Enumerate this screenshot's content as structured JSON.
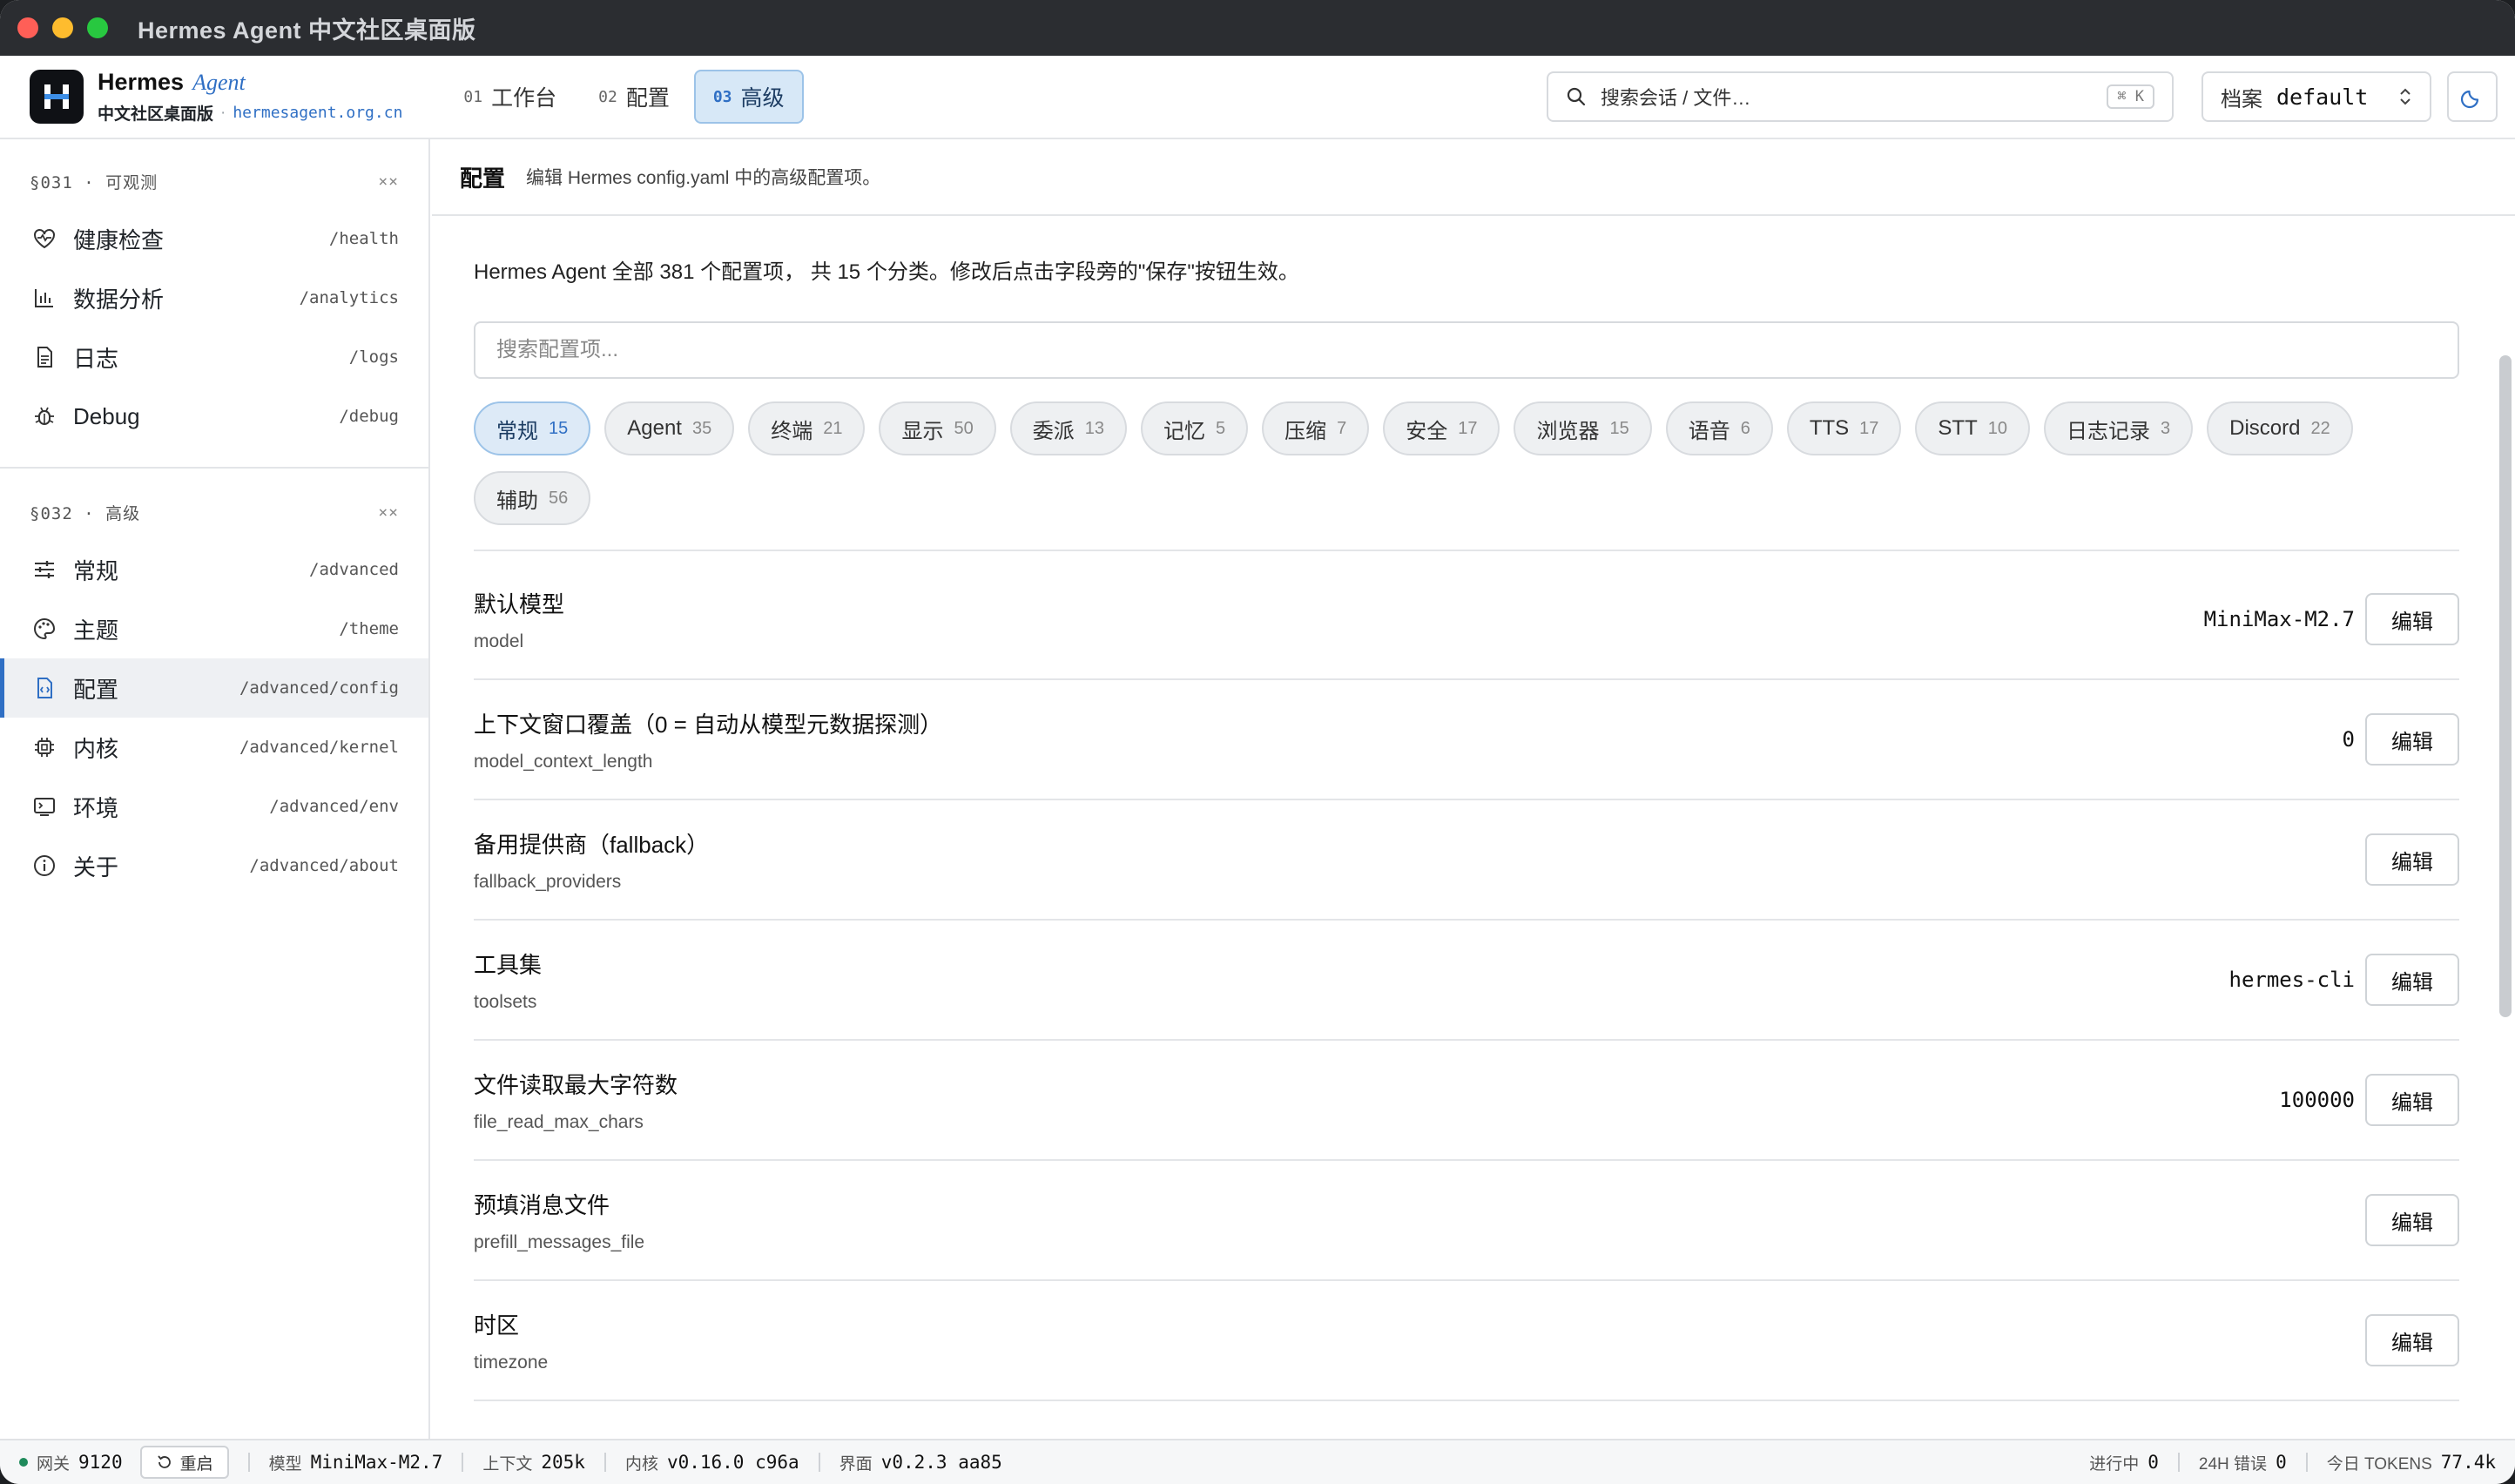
{
  "window": {
    "title": "Hermes Agent 中文社区桌面版"
  },
  "brand": {
    "name": "Hermes",
    "agent": "Agent",
    "subtitle": "中文社区桌面版",
    "sep": "·",
    "url": "hermesagent.org.cn"
  },
  "nav": {
    "tabs": [
      {
        "num": "01",
        "label": "工作台",
        "active": false
      },
      {
        "num": "02",
        "label": "配置",
        "active": false
      },
      {
        "num": "03",
        "label": "高级",
        "active": true
      }
    ]
  },
  "search": {
    "placeholder": "搜索会话 / 文件…",
    "shortcut": "⌘ K"
  },
  "profile": {
    "label": "档案",
    "value": "default"
  },
  "sidebar": {
    "sections": [
      {
        "code": "§031 · 可观测",
        "close": "××",
        "items": [
          {
            "label": "健康检查",
            "path": "/health",
            "icon": "heart-pulse-icon"
          },
          {
            "label": "数据分析",
            "path": "/analytics",
            "icon": "bar-chart-icon"
          },
          {
            "label": "日志",
            "path": "/logs",
            "icon": "file-text-icon"
          },
          {
            "label": "Debug",
            "path": "/debug",
            "icon": "bug-icon"
          }
        ]
      },
      {
        "code": "§032 · 高级",
        "close": "××",
        "items": [
          {
            "label": "常规",
            "path": "/advanced",
            "icon": "sliders-icon"
          },
          {
            "label": "主题",
            "path": "/theme",
            "icon": "palette-icon"
          },
          {
            "label": "配置",
            "path": "/advanced/config",
            "icon": "file-code-icon",
            "active": true
          },
          {
            "label": "内核",
            "path": "/advanced/kernel",
            "icon": "cpu-icon"
          },
          {
            "label": "环境",
            "path": "/advanced/env",
            "icon": "terminal-icon"
          },
          {
            "label": "关于",
            "path": "/advanced/about",
            "icon": "info-icon"
          }
        ]
      }
    ]
  },
  "page": {
    "title": "配置",
    "description": "编辑 Hermes config.yaml 中的高级配置项。",
    "intro": "Hermes Agent 全部 381 个配置项， 共 15 个分类。修改后点击字段旁的\"保存\"按钮生效。",
    "search_placeholder": "搜索配置项..."
  },
  "categories": [
    {
      "label": "常规",
      "count": "15",
      "active": true
    },
    {
      "label": "Agent",
      "count": "35"
    },
    {
      "label": "终端",
      "count": "21"
    },
    {
      "label": "显示",
      "count": "50"
    },
    {
      "label": "委派",
      "count": "13"
    },
    {
      "label": "记忆",
      "count": "5"
    },
    {
      "label": "压缩",
      "count": "7"
    },
    {
      "label": "安全",
      "count": "17"
    },
    {
      "label": "浏览器",
      "count": "15"
    },
    {
      "label": "语音",
      "count": "6"
    },
    {
      "label": "TTS",
      "count": "17"
    },
    {
      "label": "STT",
      "count": "10"
    },
    {
      "label": "日志记录",
      "count": "3"
    },
    {
      "label": "Discord",
      "count": "22"
    },
    {
      "label": "辅助",
      "count": "56"
    }
  ],
  "config_rows": [
    {
      "name": "默认模型",
      "key": "model",
      "value": "MiniMax-M2.7",
      "edit": "编辑"
    },
    {
      "name": "上下文窗口覆盖（0 = 自动从模型元数据探测）",
      "key": "model_context_length",
      "value": "0",
      "edit": "编辑"
    },
    {
      "name": "备用提供商（fallback）",
      "key": "fallback_providers",
      "value": "",
      "edit": "编辑"
    },
    {
      "name": "工具集",
      "key": "toolsets",
      "value": "hermes-cli",
      "edit": "编辑"
    },
    {
      "name": "文件读取最大字符数",
      "key": "file_read_max_chars",
      "value": "100000",
      "edit": "编辑"
    },
    {
      "name": "预填消息文件",
      "key": "prefill_messages_file",
      "value": "",
      "edit": "编辑"
    },
    {
      "name": "时区",
      "key": "timezone",
      "value": "",
      "edit": "编辑"
    }
  ],
  "status": {
    "gateway_label": "网关",
    "gateway_port": "9120",
    "restart_label": "重启",
    "model_label": "模型",
    "model": "MiniMax-M2.7",
    "context_label": "上下文",
    "context": "205k",
    "kernel_label": "内核",
    "kernel": "v0.16.0 c96a",
    "ui_label": "界面",
    "ui": "v0.2.3 aa85",
    "running_label": "进行中",
    "running": "0",
    "errors_label": "24H 错误",
    "errors": "0",
    "tokens_label": "今日 TOKENS",
    "tokens": "77.4k"
  },
  "colors": {
    "accent": "#2f6fc4",
    "status_ok": "#1f8a5b",
    "titlebar": "#2b2d31"
  }
}
